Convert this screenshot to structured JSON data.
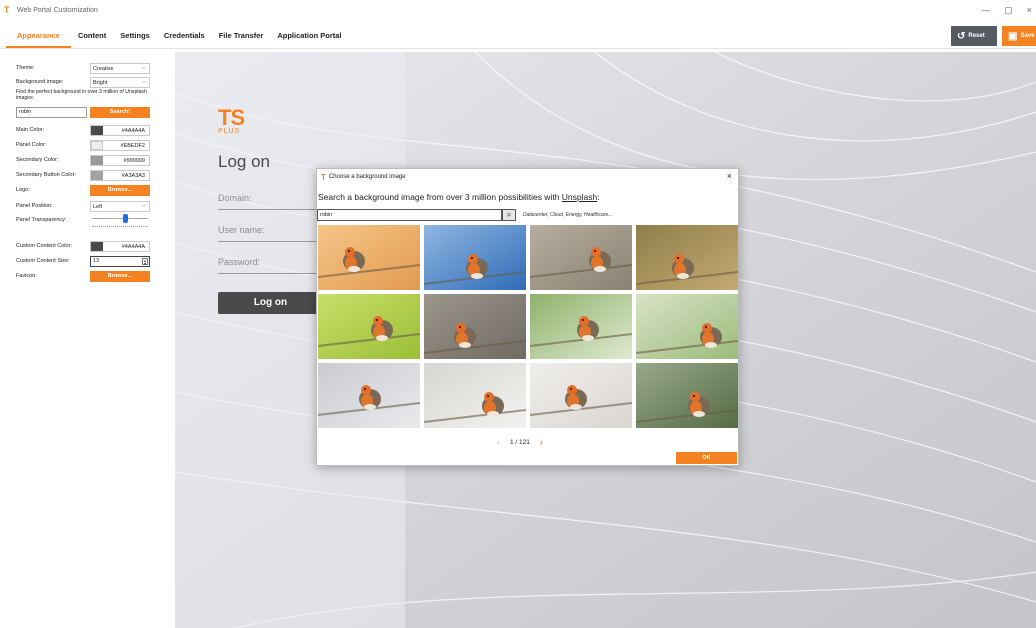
{
  "window": {
    "title": "Web Portal Customization",
    "minimize": "—",
    "maximize": "▢",
    "close": "×"
  },
  "tabs": [
    "Appearance",
    "Content",
    "Settings",
    "Credentials",
    "File Transfer",
    "Application Portal"
  ],
  "active_tab": "Appearance",
  "toolbar": {
    "reset_label": "Reset",
    "save_label": "Save"
  },
  "settings": {
    "theme_label": "Theme:",
    "theme_value": "Creative",
    "bg_image_label": "Background image:",
    "bg_image_value": "Bright",
    "help_text": "Find the perfect background in over 3 million of Unsplash images:",
    "search_value": "robin",
    "search_button": "Search!",
    "main_color_label": "Main Color:",
    "main_color_value": "#4A4A4A",
    "panel_color_label": "Panel Color:",
    "panel_color_value": "#EBEDF2",
    "secondary_color_label": "Secondary Color:",
    "secondary_color_value": "#999999",
    "secondary_button_color_label": "Secondary Button Color:",
    "secondary_button_color_value": "#A3A3A3",
    "logo_label": "Logo:",
    "logo_button": "Browse...",
    "panel_position_label": "Panel Position:",
    "panel_position_value": "Left",
    "panel_transparency_label": "Panel Transparency:",
    "panel_transparency_level": 0.6,
    "custom_content_color_label": "Custom Content Color:",
    "custom_content_color_value": "#4A4A4A",
    "custom_content_size_label": "Custom Content Size:",
    "custom_content_size_value": "13",
    "favicon_label": "Favicon:",
    "favicon_button": "Browse..."
  },
  "preview": {
    "logo_main": "TS",
    "logo_sub": "PLUS",
    "title": "Log on",
    "domain_placeholder": "Domain:",
    "username_placeholder": "User name:",
    "password_placeholder": "Password:",
    "logon_button": "Log on"
  },
  "dialog": {
    "title": "Choose a background image",
    "close": "×",
    "heading_prefix": "Search a background image from over 3 million possibilities with ",
    "heading_link": "Unsplash",
    "heading_suffix": ":",
    "search_value": "robin",
    "hint": "Datacenter, Cloud, Energy, Healthcare...",
    "page_text": "1 / 121",
    "prev": "‹",
    "next": "›",
    "ok_button": "OK",
    "thumbnails": [
      {
        "bg": "#e39a4e",
        "bg2": "#f3c689"
      },
      {
        "bg": "#2f6cb8",
        "bg2": "#8fb6e0"
      },
      {
        "bg": "#8a8273",
        "bg2": "#b7ada0"
      },
      {
        "bg": "#c4a972",
        "bg2": "#8f7f4a"
      },
      {
        "bg": "#9bbf36",
        "bg2": "#c9dd6a"
      },
      {
        "bg": "#6f6b64",
        "bg2": "#9c958a"
      },
      {
        "bg": "#dfe9d0",
        "bg2": "#8fb26b"
      },
      {
        "bg": "#9bbb7a",
        "bg2": "#d8e3c7"
      },
      {
        "bg": "#e9eaec",
        "bg2": "#c9cbcf"
      },
      {
        "bg": "#f2f2f0",
        "bg2": "#d6d6d2"
      },
      {
        "bg": "#d9d6d2",
        "bg2": "#f0eeeb"
      },
      {
        "bg": "#556b45",
        "bg2": "#98a98a"
      }
    ]
  },
  "colors": {
    "accent": "#f58220",
    "dark": "#4a4a4a",
    "reset_bg": "#555a60"
  }
}
